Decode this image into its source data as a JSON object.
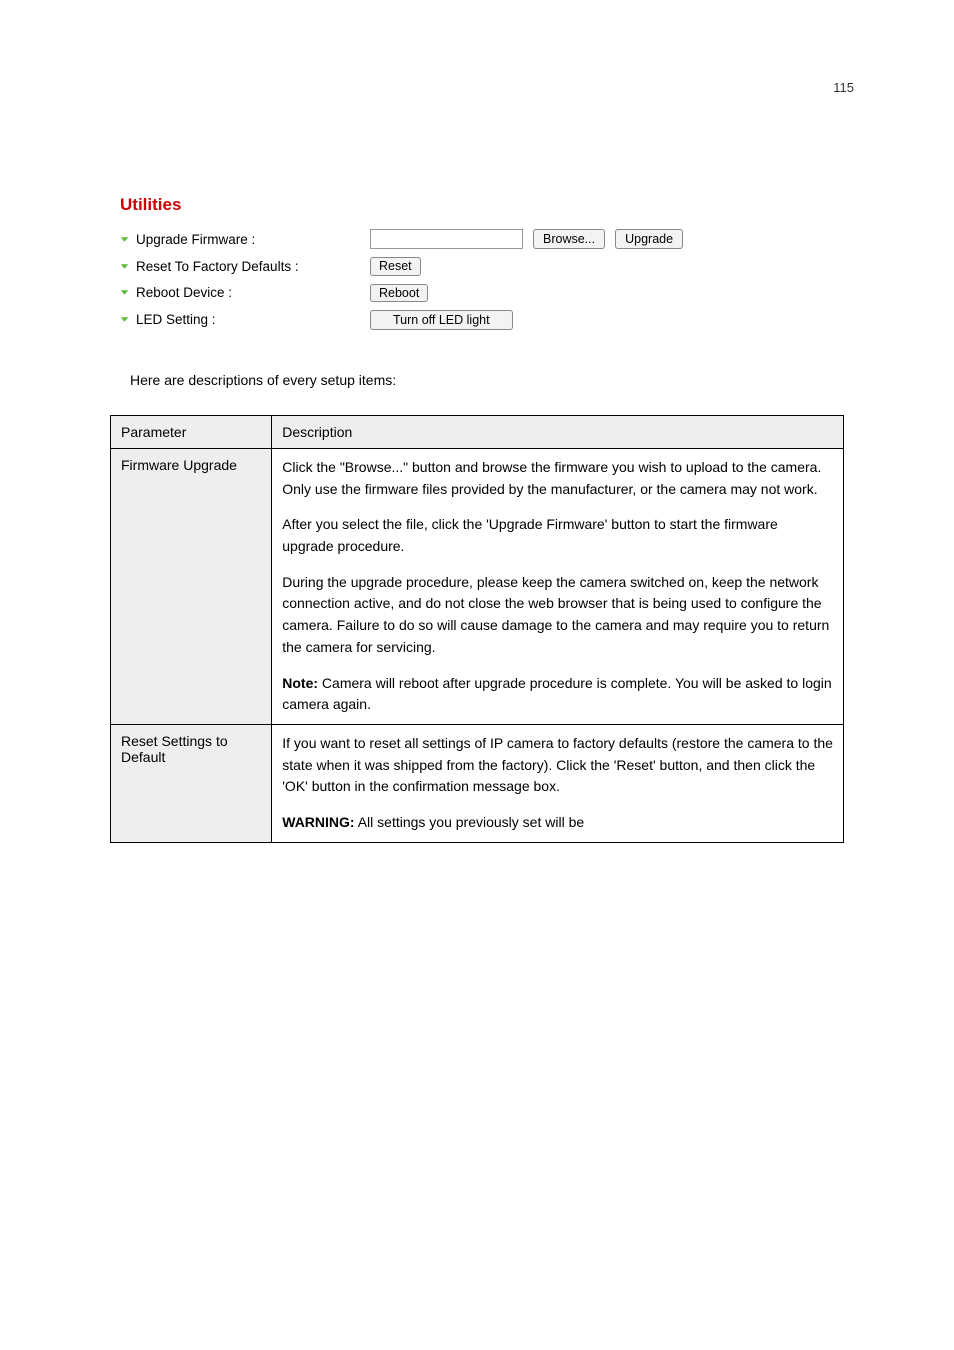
{
  "page_number": "115",
  "screenshot": {
    "title": "Utilities",
    "rows": [
      {
        "label": "Upgrade Firmware :",
        "browse": "Browse...",
        "upgrade": "Upgrade"
      },
      {
        "label": "Reset To Factory Defaults :",
        "button": "Reset"
      },
      {
        "label": "Reboot Device :",
        "button": "Reboot"
      },
      {
        "label": "LED Setting :",
        "button": "Turn off LED light"
      }
    ]
  },
  "description": "Here are descriptions of every setup items:",
  "table": {
    "head": [
      "Parameter",
      "Description"
    ],
    "rows": [
      {
        "param": "Firmware Upgrade",
        "text": [
          "Click the \"Browse...\" button and browse the firmware you wish to upload to the camera. Only use the firmware files provided by the manufacturer, or the camera may not work.",
          "After you select the file, click the 'Upgrade Firmware' button to start the firmware upgrade procedure.",
          "During the upgrade procedure, please keep the camera switched on, keep the network connection active, and do not close the web browser that is being used to configure the camera. Failure to do so will cause damage to the camera and may require you to return the camera for servicing."
        ],
        "note_label": "Note:",
        "note_text": "Camera will reboot after upgrade procedure is complete. You will be asked to login camera again."
      },
      {
        "param": "Reset Settings to Default",
        "text": [
          "If you want to reset all settings of IP camera to factory defaults (restore the camera to the state when it was shipped from the factory). Click the 'Reset' button, and then click the 'OK' button in the confirmation message box."
        ],
        "warn_label": "WARNING:",
        "warn_text": "All settings you previously set will be"
      }
    ]
  }
}
